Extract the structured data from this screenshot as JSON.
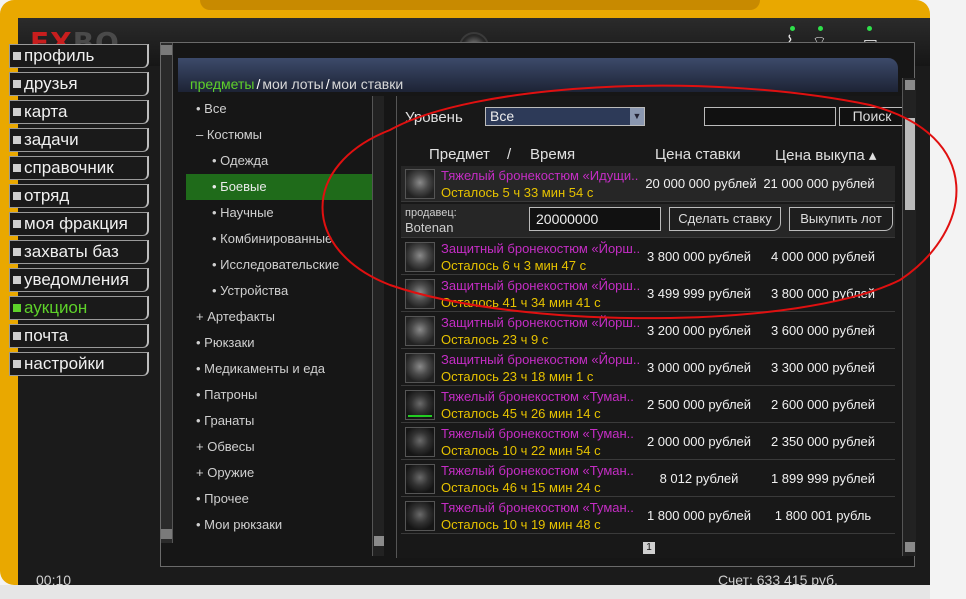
{
  "app": {
    "logo_a": "EX",
    "logo_b": "BO"
  },
  "menu": [
    {
      "label": "профиль",
      "id": "profile"
    },
    {
      "label": "друзья",
      "id": "friends"
    },
    {
      "label": "карта",
      "id": "map"
    },
    {
      "label": "задачи",
      "id": "tasks"
    },
    {
      "label": "справочник",
      "id": "reference"
    },
    {
      "label": "отряд",
      "id": "squad"
    },
    {
      "label": "моя фракция",
      "id": "faction"
    },
    {
      "label": "захваты баз",
      "id": "base-captures"
    },
    {
      "label": "уведомления",
      "id": "notifications"
    },
    {
      "label": "аукцион",
      "id": "auction",
      "active": true
    },
    {
      "label": "почта",
      "id": "mail"
    },
    {
      "label": "настройки",
      "id": "settings"
    }
  ],
  "tabs": {
    "items": "предметы",
    "my_lots": "мои лоты",
    "my_bids": "мои ставки",
    "sep": "/"
  },
  "categories": [
    {
      "label": "• Все"
    },
    {
      "label": "– Костюмы"
    },
    {
      "label": "• Одежда",
      "sub": true
    },
    {
      "label": "• Боевые",
      "sub": true,
      "active": true
    },
    {
      "label": "• Научные",
      "sub": true
    },
    {
      "label": "• Комбинированные",
      "sub": true
    },
    {
      "label": "• Исследовательские",
      "sub": true
    },
    {
      "label": "• Устройства",
      "sub": true
    },
    {
      "label": "+ Артефакты"
    },
    {
      "label": "• Рюкзаки"
    },
    {
      "label": "• Медикаменты и еда"
    },
    {
      "label": "• Патроны"
    },
    {
      "label": "• Гранаты"
    },
    {
      "label": "+ Обвесы"
    },
    {
      "label": "+ Оружие"
    },
    {
      "label": "• Прочее"
    },
    {
      "label": "• Мои рюкзаки"
    }
  ],
  "filters": {
    "level_label": "Уровень",
    "level_value": "Все",
    "search_button": "Поиск",
    "search_value": ""
  },
  "table_header": {
    "item": "Предмет",
    "sep": "/",
    "time": "Время",
    "bid": "Цена ставки",
    "buyout": "Цена выкупа ▴"
  },
  "selected_lot": {
    "name": "Тяжелый бронекостюм «Идущи..",
    "time": "Осталось 5 ч 33 мин 54 с",
    "bid": "20 000 000 рублей",
    "buyout": "21 000 000 рублей",
    "seller_label": "продавец:",
    "seller": "Botenan",
    "bid_input": "20000000",
    "bid_button": "Сделать ставку",
    "buyout_button": "Выкупить лот"
  },
  "lots": [
    {
      "name": "Защитный бронекостюм «Йорш..",
      "time": "Осталось 6 ч 3 мин 47 с",
      "bid": "3 800 000 рублей",
      "buyout": "4 000 000 рублей"
    },
    {
      "name": "Защитный бронекостюм «Йорш..",
      "time": "Осталось 41 ч 34 мин 41 с",
      "bid": "3 499 999 рублей",
      "buyout": "3 800 000 рублей"
    },
    {
      "name": "Защитный бронекостюм «Йорш..",
      "time": "Осталось 23 ч 9 с",
      "bid": "3 200 000 рублей",
      "buyout": "3 600 000 рублей"
    },
    {
      "name": "Защитный бронекостюм «Йорш..",
      "time": "Осталось 23 ч 18 мин 1 с",
      "bid": "3 000 000 рублей",
      "buyout": "3 300 000 рублей"
    },
    {
      "name": "Тяжелый бронекостюм «Туман..",
      "time": "Осталось 45 ч 26 мин 14 с",
      "bid": "2 500 000 рублей",
      "buyout": "2 600 000 рублей",
      "dark": true
    },
    {
      "name": "Тяжелый бронекостюм «Туман..",
      "time": "Осталось 10 ч 22 мин 54 с",
      "bid": "2 000 000 рублей",
      "buyout": "2 350 000 рублей",
      "dark": true
    },
    {
      "name": "Тяжелый бронекостюм «Туман..",
      "time": "Осталось 46 ч 15 мин 24 с",
      "bid": "8 012 рублей",
      "buyout": "1 899 999 рублей",
      "dark": true
    },
    {
      "name": "Тяжелый бронекостюм «Туман..",
      "time": "Осталось 10 ч 19 мин 48 с",
      "bid": "1 800 000 рублей",
      "buyout": "1 800 001 рубль",
      "dark": true
    }
  ],
  "pager": {
    "page": "1"
  },
  "footer": {
    "left": "00:10",
    "right": "Счет: 633 415 руб."
  },
  "colors": {
    "device": "#e9a800",
    "accent_green": "#5ed12a",
    "item_name": "#c42dc4",
    "time": "#e6c200",
    "annotation": "#e01010"
  }
}
